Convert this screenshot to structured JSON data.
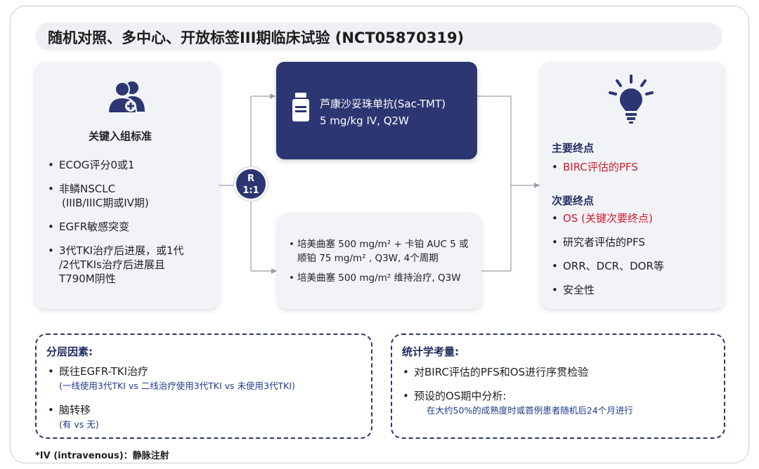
{
  "title": "随机对照、多中心、开放标签III期临床试验 (NCT05870319)",
  "colors": {
    "navy": "#2b3672",
    "red": "#d11a2a",
    "card_bg": "#f1f3f7"
  },
  "inclusion": {
    "icon": "people-add-icon",
    "heading": "关键入组标准",
    "items": [
      {
        "line1": "ECOG评分0或1",
        "line2": ""
      },
      {
        "line1": "非鳞NSCLC",
        "line2": "(IIIB/IIIC期或IV期)"
      },
      {
        "line1": "EGFR敏感突变",
        "line2": ""
      },
      {
        "line1": "3代TKI治疗后进展，或1代",
        "line2": "/2代TKIs治疗后进展且",
        "line3": "T790M阴性"
      }
    ]
  },
  "randomization": {
    "line1": "R",
    "line2": "1:1"
  },
  "arm_sac": {
    "icon": "medicine-bottle-icon",
    "line1": "芦康沙妥珠单抗(Sac-TMT)",
    "line2": "5 mg/kg IV, Q2W"
  },
  "arm_chemo": {
    "item1_line1": "培美曲塞 500 mg/m² + 卡铂 AUC 5 或",
    "item1_line2": "顺铂 75 mg/m² , Q3W,  4个周期",
    "item2": "培美曲塞 500 mg/m² 维持治疗, Q3W"
  },
  "endpoints": {
    "icon": "lightbulb-icon",
    "primary_heading": "主要终点",
    "primary_items": [
      "BIRC评估的PFS"
    ],
    "secondary_heading": "次要终点",
    "secondary_items": [
      "OS (关键次要终点)",
      "研究者评估的PFS",
      "ORR、DCR、DOR等",
      "安全性"
    ]
  },
  "stratification": {
    "heading": "分层因素:",
    "items": [
      {
        "label": "既往EGFR-TKI治疗",
        "detail": "(一线使用3代TKI vs 二线治疗使用3代TKI vs 未使用3代TKI)"
      },
      {
        "label": "脑转移",
        "detail": "(有 vs 无)"
      }
    ]
  },
  "statistics": {
    "heading": "统计学考量:",
    "items": [
      {
        "label": "对BIRC评估的PFS和OS进行序贯检验",
        "detail": ""
      },
      {
        "label": "预设的OS期中分析:",
        "detail": "在大约50%的成熟度时或首例患者随机后24个月进行"
      }
    ]
  },
  "footnote": "*IV (intravenous)：静脉注射"
}
